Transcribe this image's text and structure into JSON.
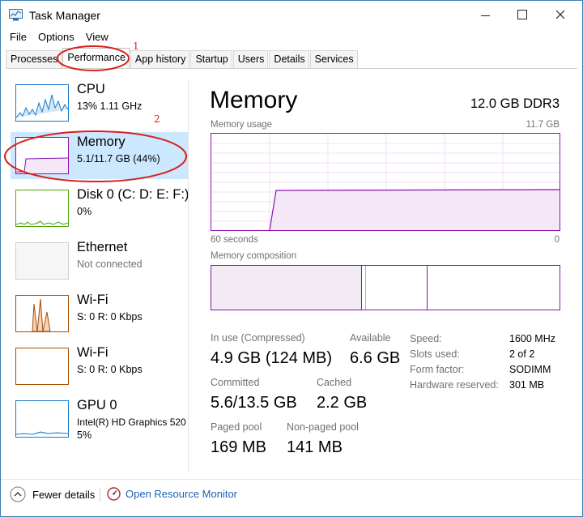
{
  "window": {
    "title": "Task Manager",
    "minimize": "—",
    "maximize": "☐",
    "close": "✕"
  },
  "menu": [
    "File",
    "Options",
    "View"
  ],
  "tabs": [
    {
      "label": "Processes",
      "active": false
    },
    {
      "label": "Performance",
      "active": true
    },
    {
      "label": "App history",
      "active": false
    },
    {
      "label": "Startup",
      "active": false
    },
    {
      "label": "Users",
      "active": false
    },
    {
      "label": "Details",
      "active": false
    },
    {
      "label": "Services",
      "active": false
    }
  ],
  "annotations": {
    "tab_marker": "1",
    "item_marker": "2",
    "color": "#d8211c"
  },
  "sidebar": [
    {
      "name": "CPU",
      "sub": "13%  1.11 GHz",
      "sub2": "",
      "color": "#1979ca"
    },
    {
      "name": "Memory",
      "sub": "5.1/11.7 GB (44%)",
      "sub2": "",
      "color": "#8b12ae"
    },
    {
      "name": "Disk 0 (C: D: E: F:)",
      "sub": "0%",
      "sub2": "",
      "color": "#4da60c"
    },
    {
      "name": "Ethernet",
      "sub": "Not connected",
      "sub2": "",
      "color": "#a74f01"
    },
    {
      "name": "Wi-Fi",
      "sub": "S: 0  R: 0 Kbps",
      "sub2": "",
      "color": "#a74f01"
    },
    {
      "name": "Wi-Fi",
      "sub": "S: 0  R: 0 Kbps",
      "sub2": "",
      "color": "#a74f01"
    },
    {
      "name": "GPU 0",
      "sub": "Intel(R) HD Graphics 520",
      "sub2": "5%",
      "color": "#1979ca"
    }
  ],
  "main": {
    "title": "Memory",
    "spec": "12.0 GB DDR3",
    "usage_label": "Memory usage",
    "usage_max": "11.7 GB",
    "time_left": "60 seconds",
    "time_right": "0",
    "composition_label": "Memory composition",
    "stats": {
      "in_use_label": "In use (Compressed)",
      "in_use_value": "4.9 GB (124 MB)",
      "available_label": "Available",
      "available_value": "6.6 GB",
      "committed_label": "Committed",
      "committed_value": "5.6/13.5 GB",
      "cached_label": "Cached",
      "cached_value": "2.2 GB",
      "paged_label": "Paged pool",
      "paged_value": "169 MB",
      "nonpaged_label": "Non-paged pool",
      "nonpaged_value": "141 MB"
    },
    "details": [
      {
        "label": "Speed:",
        "value": "1600 MHz"
      },
      {
        "label": "Slots used:",
        "value": "2 of 2"
      },
      {
        "label": "Form factor:",
        "value": "SODIMM"
      },
      {
        "label": "Hardware reserved:",
        "value": "301 MB"
      }
    ],
    "accent": "#8b12ae"
  },
  "footer": {
    "fewer_details": "Fewer details",
    "resource_monitor": "Open Resource Monitor"
  }
}
